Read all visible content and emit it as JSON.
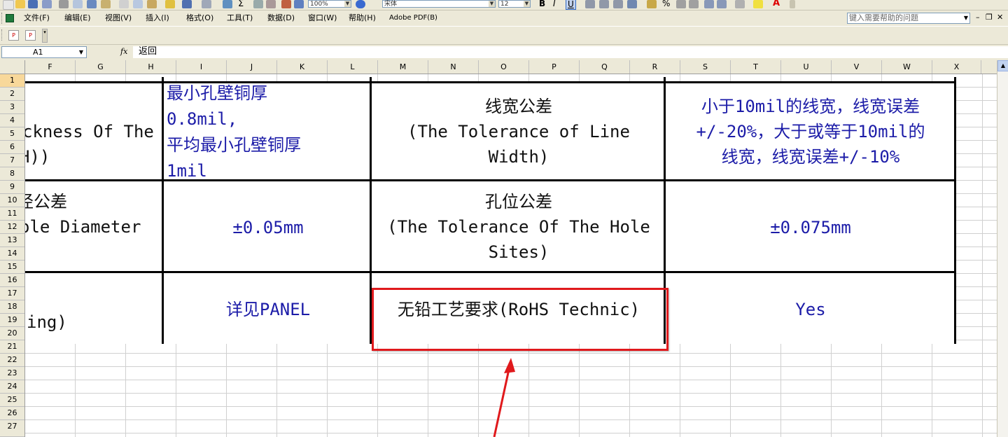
{
  "toolbar": {
    "zoom_value": "100%",
    "font_value": "宋体",
    "size_value": "12",
    "bold_label": "B",
    "italic_label": "I",
    "underline_label": "U",
    "sum_label": "Σ",
    "percent_label": "%",
    "font_color_label": "A"
  },
  "menu": {
    "items": [
      "文件(F)",
      "编辑(E)",
      "视图(V)",
      "插入(I)",
      "格式(O)",
      "工具(T)",
      "数据(D)",
      "窗口(W)",
      "帮助(H)",
      "Adobe PDF(B)"
    ],
    "help_placeholder": "键入需要帮助的问题",
    "min_label": "–",
    "restore_label": "❐",
    "close_label": "✕"
  },
  "formula_bar": {
    "name_box": "A1",
    "fx_label": "fx",
    "formula": "返回"
  },
  "columns": [
    "F",
    "G",
    "H",
    "I",
    "J",
    "K",
    "L",
    "M",
    "N",
    "O",
    "P",
    "Q",
    "R",
    "S",
    "T",
    "U",
    "V",
    "W",
    "X"
  ],
  "rows": [
    "1",
    "2",
    "3",
    "4",
    "5",
    "6",
    "7",
    "8",
    "9",
    "10",
    "11",
    "12",
    "13",
    "14",
    "15",
    "16",
    "17",
    "18",
    "19",
    "20",
    "21",
    "22",
    "23",
    "24",
    "25",
    "26",
    "27"
  ],
  "table": {
    "r1c1": [
      "ckness Of The",
      "H))"
    ],
    "r1c2": [
      "最小孔壁铜厚",
      "0.8mil,",
      "平均最小孔壁铜厚",
      "1mil"
    ],
    "r1c3": [
      "线宽公差",
      "(The Tolerance of Line",
      "Width)"
    ],
    "r1c4": [
      "小于10mil的线宽，线宽误差",
      "+/-20%，大于或等于10mil的",
      "线宽，线宽误差+/-10%"
    ],
    "r2c1": [
      "径公差",
      "ole Diameter"
    ],
    "r2c2": "±0.05mm",
    "r2c3": [
      "孔位公差",
      "(The Tolerance Of The Hole",
      "Sites)"
    ],
    "r2c4": "±0.075mm",
    "r3c1": "ing)",
    "r3c2": "详见PANEL",
    "r3c3": "无铅工艺要求(RoHS Technic)",
    "r3c4": "Yes"
  },
  "annotation": {
    "box_color": "#e0191c",
    "arrow_color": "#e0191c"
  }
}
